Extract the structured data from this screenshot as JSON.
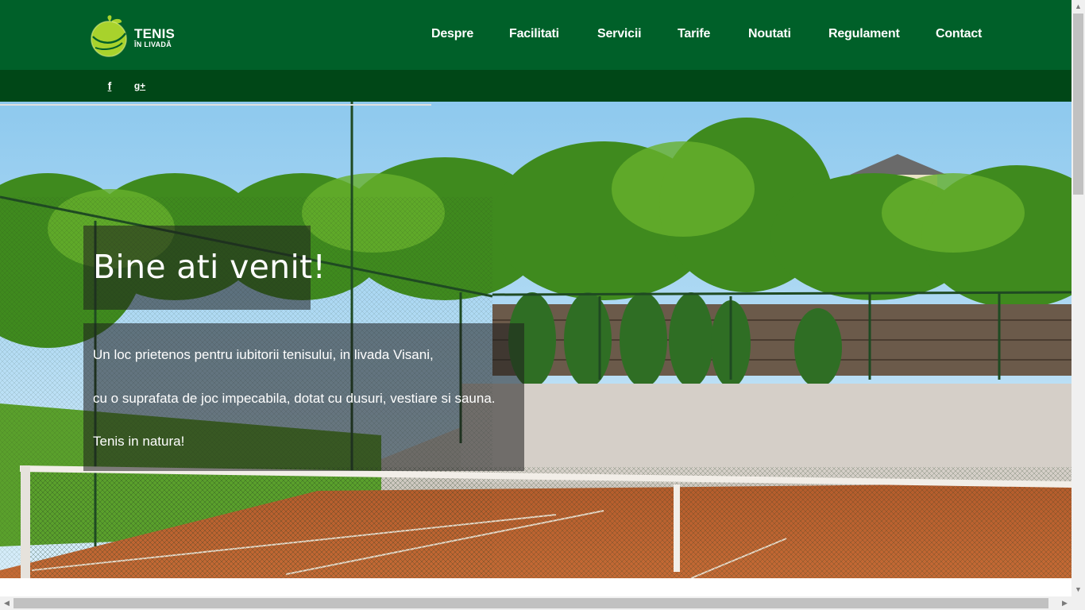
{
  "brand": {
    "line1": "TENIS",
    "line2": "ÎN LIVADĂ",
    "green": "#006029",
    "dark_green": "#004717",
    "apple": "#a8d22c"
  },
  "nav": {
    "items": [
      {
        "label": "Despre"
      },
      {
        "label": "Facilitati"
      },
      {
        "label": "Servicii"
      },
      {
        "label": "Tarife"
      },
      {
        "label": "Noutati"
      },
      {
        "label": "Regulament"
      },
      {
        "label": "Contact"
      }
    ]
  },
  "social": {
    "facebook": "f",
    "google_plus": "g+",
    "facebook_icon": "facebook-icon",
    "google_icon": "google-plus-icon"
  },
  "hero": {
    "title": "Bine ati venit!",
    "lines": [
      "Un loc prietenos pentru iubitorii tenisului, in livada Visani,",
      "cu o suprafata de joc impecabila, dotat cu dusuri, vestiare si sauna.",
      "Tenis in natura!"
    ]
  }
}
